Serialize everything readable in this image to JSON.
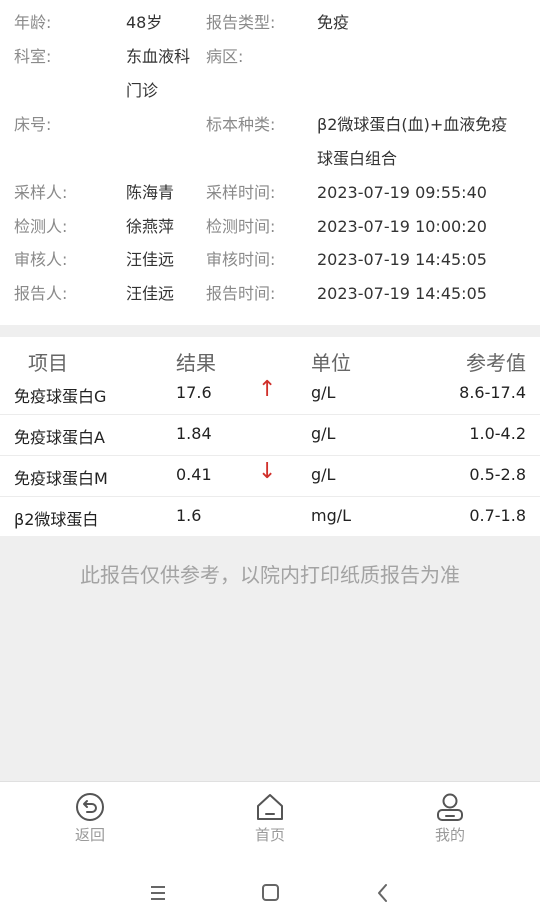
{
  "info": {
    "rows": [
      {
        "l1": "年龄:",
        "v1": "48岁",
        "l2": "报告类型:",
        "v2": "免疫"
      },
      {
        "l1": "科室:",
        "v1": "东血液科",
        "v1b": "门诊",
        "l2": "病区:",
        "v2": ""
      },
      {
        "l1": "床号:",
        "v1": "",
        "l2": "标本种类:",
        "v2": "β2微球蛋白(血)+血液免疫",
        "v2b": "球蛋白组合"
      },
      {
        "l1": "采样人:",
        "v1": "陈海青",
        "l2": "采样时间:",
        "v2": "2023-07-19 09:55:40"
      },
      {
        "l1": "检测人:",
        "v1": "徐燕萍",
        "l2": "检测时间:",
        "v2": "2023-07-19 10:00:20"
      },
      {
        "l1": "审核人:",
        "v1": "汪佳远",
        "l2": "审核时间:",
        "v2": "2023-07-19 14:45:05"
      },
      {
        "l1": "报告人:",
        "v1": "汪佳远",
        "l2": "报告时间:",
        "v2": "2023-07-19 14:45:05"
      }
    ]
  },
  "results": {
    "headers": {
      "item": "项目",
      "result": "结果",
      "unit": "单位",
      "ref": "参考值"
    },
    "rows": [
      {
        "item": "免疫球蛋白G",
        "result": "17.6",
        "flag": "↑",
        "unit": "g/L",
        "ref": "8.6-17.4"
      },
      {
        "item": "免疫球蛋白A",
        "result": "1.84",
        "flag": "",
        "unit": "g/L",
        "ref": "1.0-4.2"
      },
      {
        "item": "免疫球蛋白M",
        "result": "0.41",
        "flag": "↓",
        "unit": "g/L",
        "ref": "0.5-2.8"
      },
      {
        "item": "β2微球蛋白",
        "result": "1.6",
        "flag": "",
        "unit": "mg/L",
        "ref": "0.7-1.8"
      }
    ]
  },
  "disclaimer": "此报告仅供参考，以院内打印纸质报告为准",
  "tabbar": {
    "back": {
      "label": "返回",
      "icon": "back-circle-icon"
    },
    "home": {
      "label": "首页",
      "icon": "home-icon"
    },
    "mine": {
      "label": "我的",
      "icon": "user-icon"
    }
  },
  "system_nav": {
    "menu": "menu-icon",
    "home": "home-square-icon",
    "back": "back-chevron-icon"
  },
  "colors": {
    "flag": "#d0302b",
    "label": "#8a8a8a",
    "separator": "#efefef",
    "disclaimer": "#a3a3a3"
  }
}
